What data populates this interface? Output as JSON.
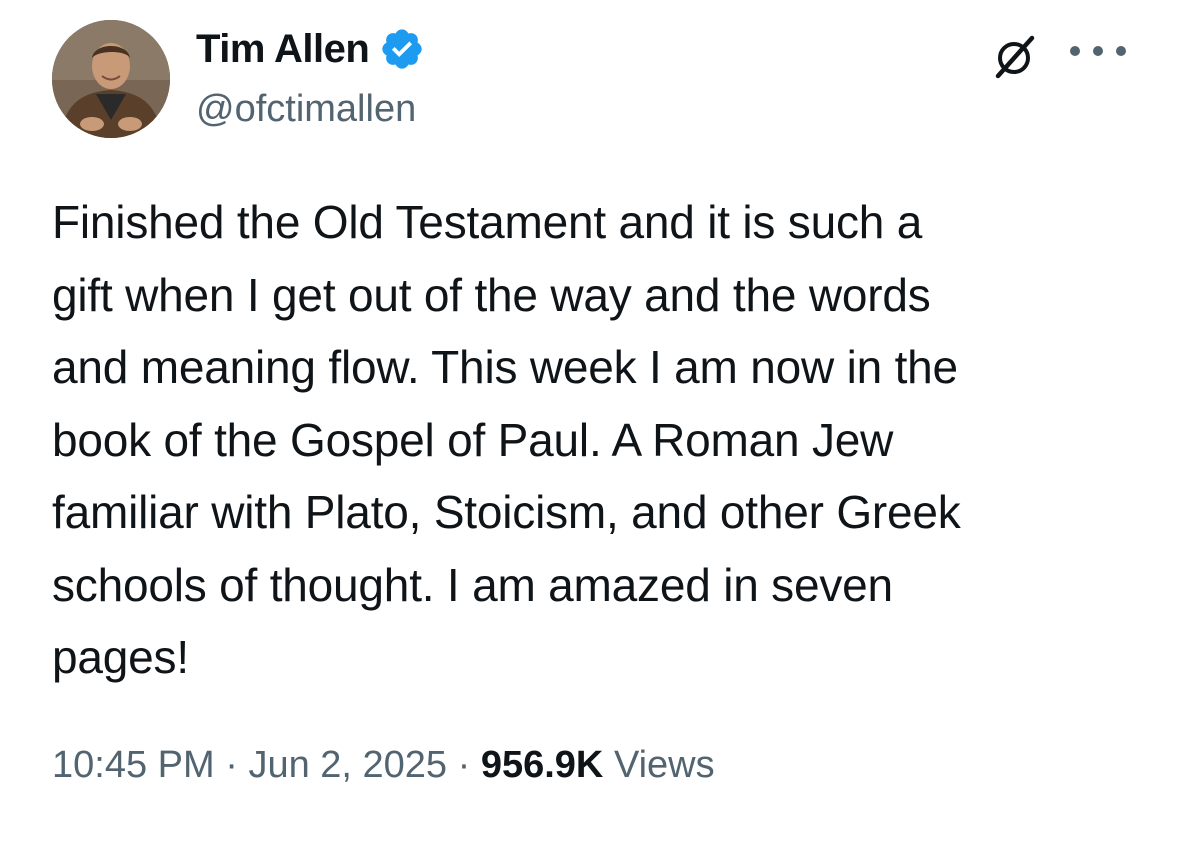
{
  "author": {
    "display_name": "Tim Allen",
    "handle": "@ofctimallen",
    "verified_icon": "verified-badge-icon",
    "verified_color": "#1d9bf0"
  },
  "header_icons": [
    "grok-icon",
    "more-options-icon"
  ],
  "tweet": {
    "text": "Finished the Old Testament and it is such a\ngift when I get out of the way and the words\nand meaning  flow. This week I am now  in the\nbook of the Gospel of Paul. A Roman Jew\nfamiliar with Plato, Stoicism, and other Greek\nschools of thought. I am amazed in seven\npages!"
  },
  "meta": {
    "time": "10:45 PM",
    "separator": "·",
    "date": "Jun 2, 2025",
    "views_count": "956.9K",
    "views_label": "Views"
  },
  "colors": {
    "text_primary": "#0f1419",
    "text_secondary": "#536471",
    "background": "#ffffff"
  }
}
